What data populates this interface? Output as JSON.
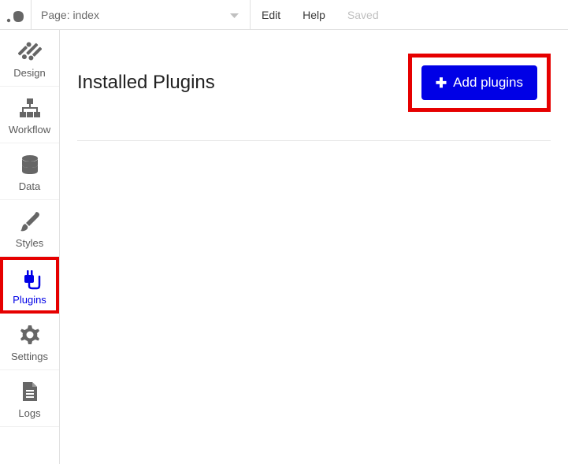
{
  "topbar": {
    "page_selector": "Page: index",
    "menu": {
      "edit": "Edit",
      "help": "Help",
      "saved": "Saved"
    }
  },
  "sidebar": {
    "items": [
      {
        "label": "Design"
      },
      {
        "label": "Workflow"
      },
      {
        "label": "Data"
      },
      {
        "label": "Styles"
      },
      {
        "label": "Plugins"
      },
      {
        "label": "Settings"
      },
      {
        "label": "Logs"
      }
    ]
  },
  "main": {
    "title": "Installed Plugins",
    "add_button": "Add plugins"
  }
}
